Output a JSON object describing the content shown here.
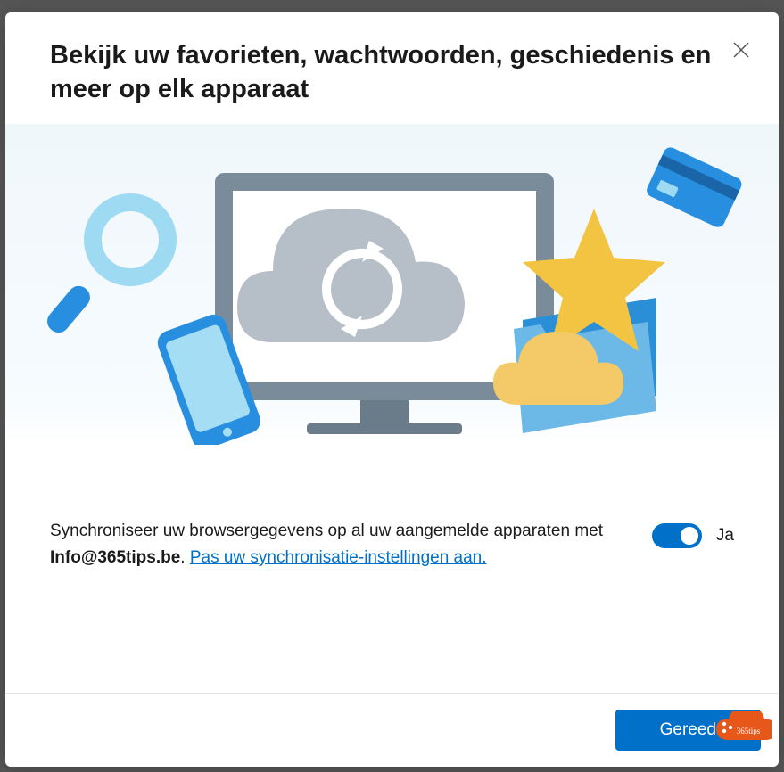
{
  "modal": {
    "title": "Bekijk uw favorieten, wachtwoorden, geschiedenis en meer op elk apparaat",
    "close_icon": "close"
  },
  "sync": {
    "text_prefix": "Synchroniseer uw browsergegevens op al uw aangemelde apparaten met ",
    "account": "Info@365tips.be",
    "text_mid": ". ",
    "link_text": "Pas uw synchronisatie-instellingen aan.",
    "toggle_label": "Ja",
    "toggle_on": true
  },
  "footer": {
    "done_label": "Gereed"
  },
  "badge": {
    "text": "365tips"
  },
  "colors": {
    "primary": "#0070c8",
    "illustration_bg": "#f0f7fb"
  }
}
